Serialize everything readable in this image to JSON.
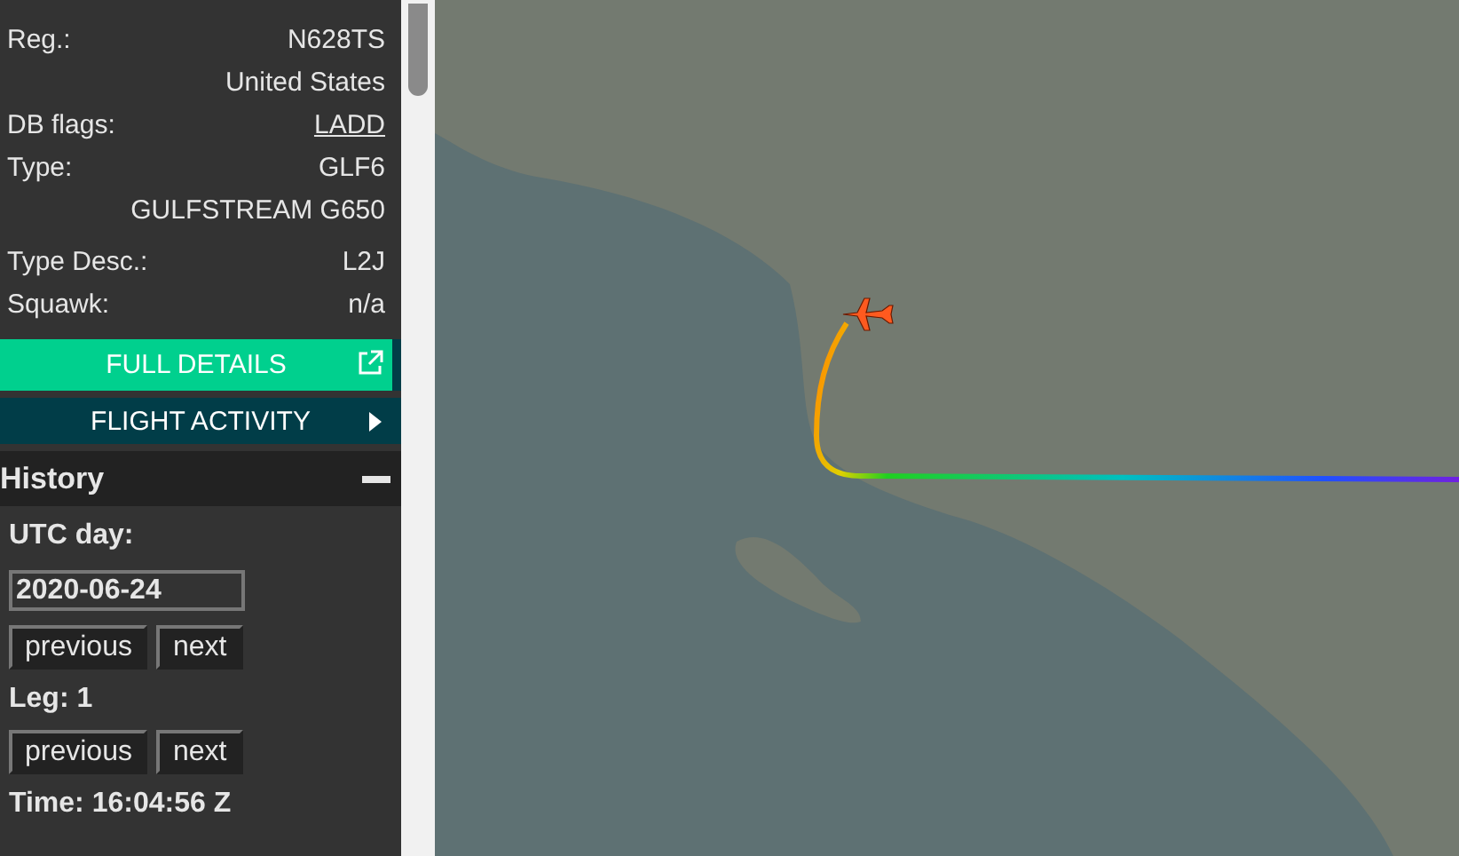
{
  "sidebar": {
    "details": [
      {
        "label": "Reg.:",
        "value": "N628TS",
        "kind": "text"
      },
      {
        "value": "United States",
        "kind": "text"
      },
      {
        "label": "DB flags:",
        "value": "LADD",
        "kind": "link"
      },
      {
        "label": "Type:",
        "value": "GLF6",
        "kind": "text"
      },
      {
        "value": "GULFSTREAM G650",
        "kind": "text"
      },
      {
        "label": "Type Desc.:",
        "value": "L2J",
        "kind": "text"
      },
      {
        "label": "Squawk:",
        "value": "n/a",
        "kind": "text"
      }
    ],
    "full_details_button": "FULL DETAILS",
    "flight_activity_button": "FLIGHT ACTIVITY",
    "history": {
      "title": "History",
      "expanded": true,
      "day_label": "UTC day:",
      "day_value": "2020-06-24",
      "day_buttons": [
        "previous",
        "next"
      ],
      "leg_label": "Leg: 1",
      "leg_buttons": [
        "previous",
        "next"
      ],
      "time": "Time: 16:04:56 Z"
    }
  }
}
